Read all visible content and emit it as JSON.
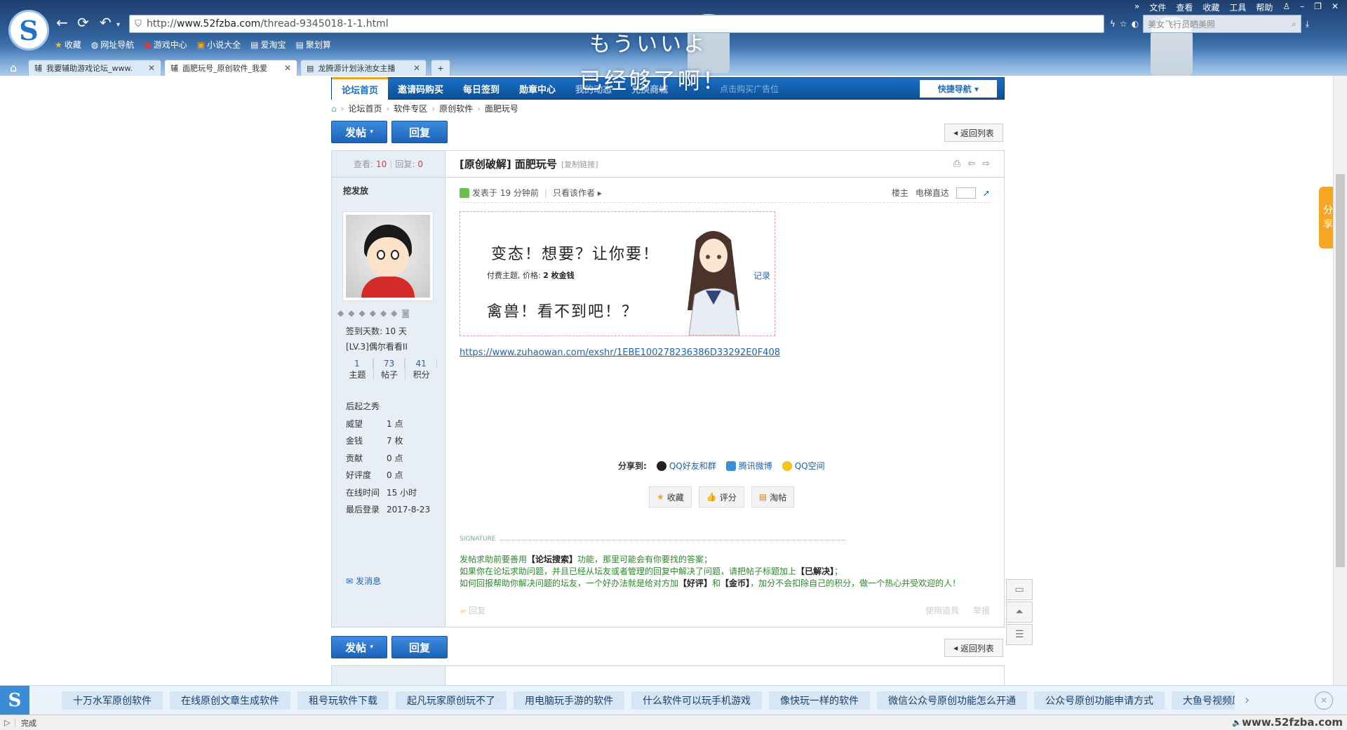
{
  "browser": {
    "url_prefix": "http://",
    "url_domain": "www.52fzba.com",
    "url_path": "/thread-9345018-1-1.html",
    "search_placeholder": "美女飞行员晒美照",
    "menu": [
      "文件",
      "查看",
      "收藏",
      "工具",
      "帮助"
    ],
    "bookmarks": [
      "收藏",
      "网址导航",
      "游戏中心",
      "小说大全",
      "爱淘宝",
      "聚划算"
    ],
    "tabs": [
      {
        "label": "我要辅助游戏论坛_www."
      },
      {
        "label": "面肥玩号_原创软件_我爱"
      },
      {
        "label": "龙腾源计划泳池女主播"
      }
    ],
    "banner_text1": "もういいよ",
    "banner_text2": "已经够了啊！"
  },
  "forum_nav": {
    "items": [
      "论坛首页",
      "邀请码购买",
      "每日签到",
      "勋章中心",
      "我的动态",
      "兑换商城"
    ],
    "ad": "点击购买广告位",
    "quick": "快捷导航"
  },
  "breadcrumb": [
    "论坛首页",
    "软件专区",
    "原创软件",
    "面肥玩号"
  ],
  "buttons": {
    "post": "发帖",
    "reply": "回复",
    "return": "返回列表"
  },
  "thread": {
    "views_label": "查看:",
    "views": "10",
    "replies_label": "回复:",
    "replies": "0",
    "title": "[原创破解] 面肥玩号",
    "copy_link": "[复制链接]"
  },
  "author": {
    "name": "挖发放",
    "checkin": "签到天数: 10 天",
    "level": "[LV.3]偶尔看看II",
    "stats": [
      {
        "value": "1",
        "label": "主题"
      },
      {
        "value": "73",
        "label": "帖子"
      },
      {
        "value": "41",
        "label": "积分"
      }
    ],
    "group": "后起之秀",
    "details": [
      {
        "k": "威望",
        "v": "1 点"
      },
      {
        "k": "金钱",
        "v": "7 枚"
      },
      {
        "k": "贡献",
        "v": "0 点"
      },
      {
        "k": "好评度",
        "v": "0 点"
      },
      {
        "k": "在线时间",
        "v": "15 小时"
      },
      {
        "k": "最后登录",
        "v": "2017-8-23"
      }
    ],
    "send_msg": "发消息"
  },
  "post_meta": {
    "posted": "发表于 19 分钟前",
    "only_author": "只看该作者",
    "floor": "楼主",
    "elevator": "电梯直达"
  },
  "locked": {
    "line1": "变态！想要？让你要！",
    "price_prefix": "付费主题, 价格: ",
    "price_value": "2 枚金钱",
    "record": "记录",
    "line2": "禽兽！看不到吧！？"
  },
  "link": "https://www.zuhaowan.com/exshr/1EBE100278236386D33292E0F408",
  "share": {
    "label": "分享到:",
    "items": [
      "QQ好友和群",
      "腾讯微博",
      "QQ空间"
    ]
  },
  "actions": [
    "收藏",
    "评分",
    "淘帖"
  ],
  "signature": {
    "header": "SIGNATURE",
    "line1_a": "发帖求助前要善用",
    "line1_b": "【论坛搜索】",
    "line1_c": "功能，那里可能会有你要找的答案；",
    "line2_a": "如果你在论坛求助问题，并且已经从坛友或者管理的回复中解决了问题，请把帖子标题加上",
    "line2_b": "【已解决】",
    "line2_c": "；",
    "line3_a": "如何回报帮助你解决问题的坛友，一个好办法就是给对方加",
    "line3_b": "【好评】",
    "line3_c": "和",
    "line3_d": "【金币】",
    "line3_e": "，加分不会扣除自己的积分，做一个热心并受欢迎的人！"
  },
  "reply_bar": {
    "reply": "回复",
    "use_tool": "使用道具",
    "report": "举报"
  },
  "side_share": [
    "分",
    "享"
  ],
  "bottom_chips": [
    "十万水军原创软件",
    "在线原创文章生成软件",
    "租号玩软件下载",
    "起凡玩家原创玩不了",
    "用电脑玩手游的软件",
    "什么软件可以玩手机游戏",
    "像快玩一样的软件",
    "微信公众号原创功能怎么开通",
    "公众号原创功能申请方式",
    "大鱼号视频原"
  ],
  "status": {
    "text": "完成",
    "watermark": "www.52fzba.com"
  }
}
